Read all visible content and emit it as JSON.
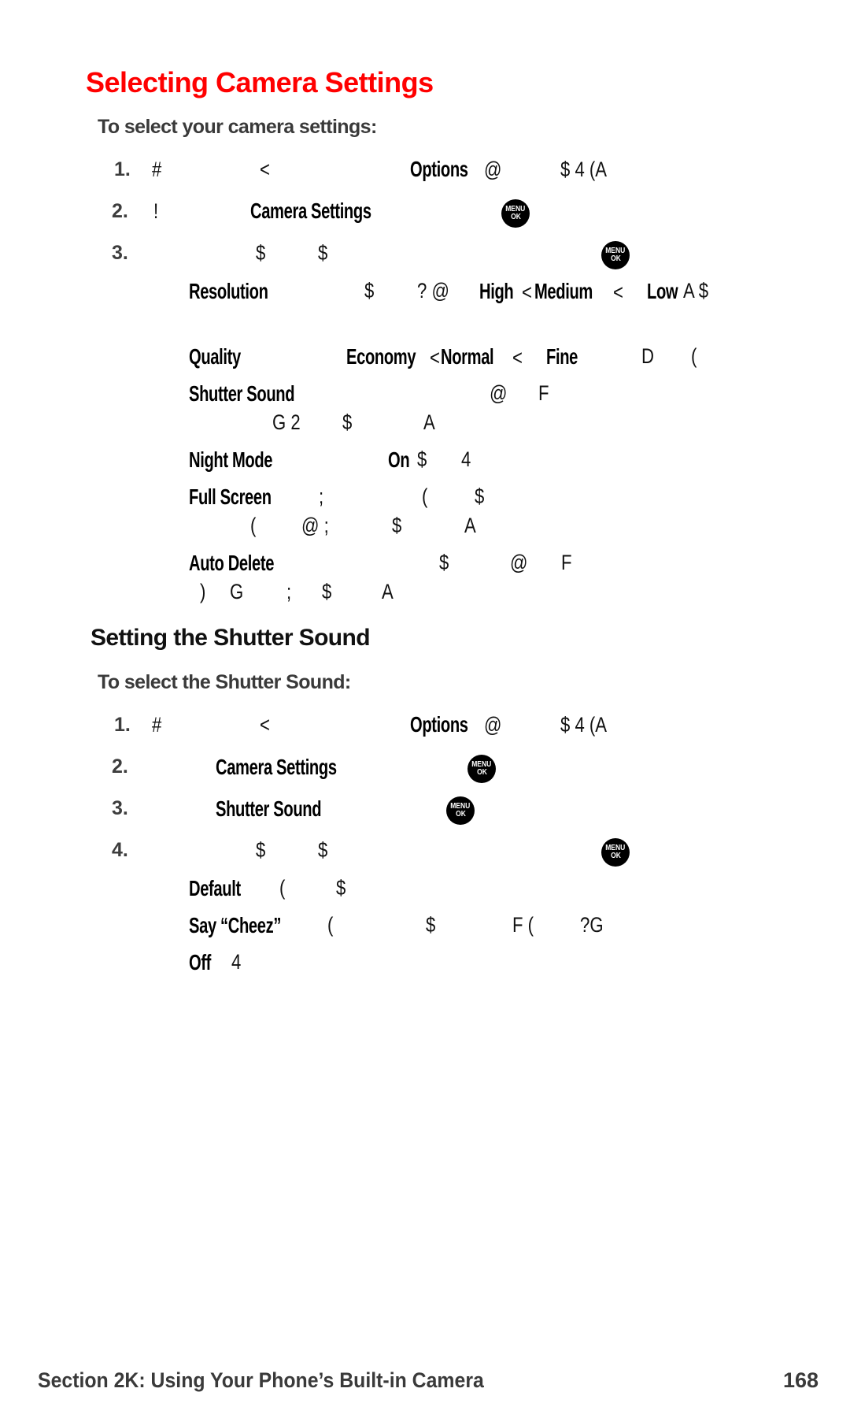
{
  "page": {
    "title": "Selecting Camera Settings",
    "title_color": "#ff0000",
    "section1": {
      "lead": "To select your camera settings:",
      "steps": [
        {
          "num": "1.",
          "glyphs": [
            "#",
            "<"
          ],
          "keyword": "Options",
          "trail": [
            "@",
            "$ 4 (A"
          ]
        },
        {
          "num": "2.",
          "glyphs": [
            "!"
          ],
          "keyword": "Camera Settings",
          "icon": "menu-ok-icon"
        },
        {
          "num": "3.",
          "glyphs": [
            "$",
            "$"
          ],
          "icon": "menu-ok-icon"
        }
      ],
      "options": [
        {
          "label": "Resolution",
          "line1": [
            "$",
            "? @"
          ],
          "values": [
            "High",
            "<",
            "Medium",
            "<",
            "Low"
          ],
          "trail": [
            "A $"
          ]
        },
        {
          "label": "Quality",
          "values": [
            "Economy",
            "<",
            "Normal",
            "<",
            "Fine"
          ],
          "trail": [
            "D",
            "("
          ]
        },
        {
          "label": "Shutter Sound",
          "line1": [
            "@",
            "F"
          ],
          "line2": [
            "G 2",
            "$",
            "A"
          ]
        },
        {
          "label": "Night Mode",
          "values": [
            "On"
          ],
          "trail": [
            "$",
            "4"
          ]
        },
        {
          "label": "Full Screen",
          "line1": [
            ";",
            "(",
            "$"
          ],
          "line2": [
            "(",
            "@ ;",
            "$",
            "A"
          ]
        },
        {
          "label": "Auto Delete",
          "line1": [
            "$",
            "@",
            "F"
          ],
          "line2": [
            ")",
            "G",
            ";",
            "$",
            "A"
          ]
        }
      ]
    },
    "section2": {
      "heading": "Setting the Shutter Sound",
      "lead": "To select the Shutter Sound:",
      "steps": [
        {
          "num": "1.",
          "glyphs": [
            "#",
            "<"
          ],
          "keyword": "Options",
          "trail": [
            "@",
            "$ 4 (A"
          ]
        },
        {
          "num": "2.",
          "keyword": "Camera Settings",
          "icon": "menu-ok-icon"
        },
        {
          "num": "3.",
          "keyword": "Shutter Sound",
          "icon": "menu-ok-icon"
        },
        {
          "num": "4.",
          "glyphs": [
            "$",
            "$"
          ],
          "icon": "menu-ok-icon"
        }
      ],
      "options": [
        {
          "label": "Default",
          "trail": [
            "(",
            "$"
          ]
        },
        {
          "label": "Say “Cheez”",
          "trail": [
            "(",
            "$",
            "F (",
            "?G"
          ]
        },
        {
          "label": "Off",
          "trail": [
            "4"
          ]
        }
      ]
    },
    "menu_icon": {
      "line1": "MENU",
      "line2": "OK"
    },
    "footer": {
      "section_label": "Section 2K: Using Your Phone’s Built-in Camera",
      "page_number": "168"
    }
  }
}
